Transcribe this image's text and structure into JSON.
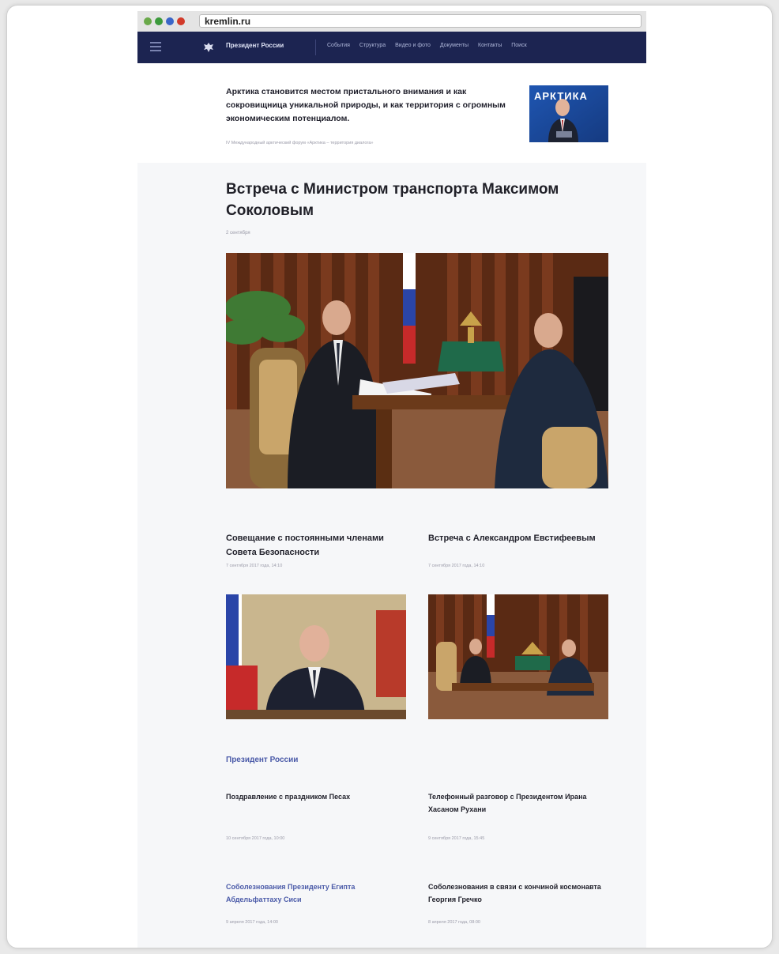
{
  "browser": {
    "url": "kremlin.ru",
    "dot_colors": [
      "#5c9c3c",
      "#2f8f2f",
      "#3a66c8",
      "#d03a2a"
    ]
  },
  "site_nav": {
    "brand": "Президент России",
    "links": [
      "События",
      "Структура",
      "Видео и фото",
      "Документы",
      "Контакты",
      "Поиск"
    ]
  },
  "quote": {
    "text": "Арктика становится местом пристального внимания и как сокровищница уникальной природы, и как территория с огромным экономическим потенциалом.",
    "source": "IV Международный арктический форум «Арктика – территория диалога»",
    "image_caption": "АРКТИКА"
  },
  "main_article": {
    "title": "Встреча с Министром транспорта Максимом Соколовым",
    "date": "2 сентября"
  },
  "cards": [
    {
      "title": "Совещание с постоянными членами Совета Безопасности",
      "date": "7 сентября 2017 года, 14:10"
    },
    {
      "title": "Встреча с Александром Евстифеевым",
      "date": "7 сентября 2017 года, 14:10"
    }
  ],
  "section": {
    "title": "Президент России",
    "news": [
      {
        "title": "Поздравление с праздником Песах",
        "date": "10 сентября 2017 года, 10:00",
        "link": false
      },
      {
        "title": "Телефонный разговор с Президентом Ирана Хасаном Рухани",
        "date": "9 сентября 2017 года, 15:45",
        "link": false
      },
      {
        "title": "Соболезнования Президенту Египта Абдельфаттаху Сиси",
        "date": "9 апреля 2017 года, 14:00",
        "link": true
      },
      {
        "title": "Соболезнования в связи с кончиной космонавта Георгия Гречко",
        "date": "8 апреля 2017 года, 08:00",
        "link": false
      }
    ]
  },
  "colors": {
    "nav_bg": "#1c2451",
    "link_blue": "#4a5aa8",
    "flag_white": "#ffffff",
    "flag_blue": "#2a45a8",
    "flag_red": "#c62a2a"
  }
}
